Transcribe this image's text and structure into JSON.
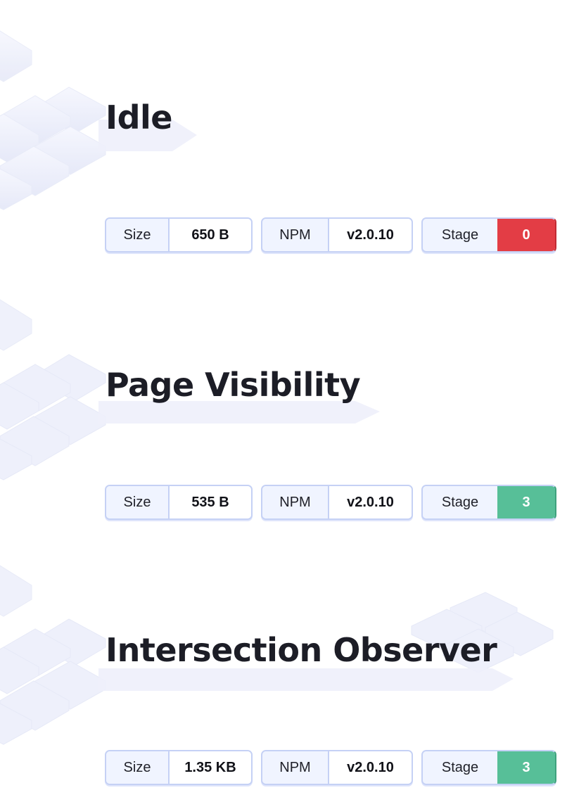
{
  "theme": {
    "stage_colors": {
      "0": "#e33d45",
      "3": "#57bf98"
    },
    "stage_border": {
      "0": "#c22b33",
      "3": "#3ea27d"
    }
  },
  "sections": [
    {
      "title": "Idle",
      "size_label": "Size",
      "size_value": "650 B",
      "npm_label": "NPM",
      "npm_value": "v2.0.10",
      "stage_label": "Stage",
      "stage_value": "0"
    },
    {
      "title": "Page Visibility",
      "size_label": "Size",
      "size_value": "535 B",
      "npm_label": "NPM",
      "npm_value": "v2.0.10",
      "stage_label": "Stage",
      "stage_value": "3"
    },
    {
      "title": "Intersection Observer",
      "size_label": "Size",
      "size_value": "1.35 KB",
      "npm_label": "NPM",
      "npm_value": "v2.0.10",
      "stage_label": "Stage",
      "stage_value": "3"
    }
  ]
}
